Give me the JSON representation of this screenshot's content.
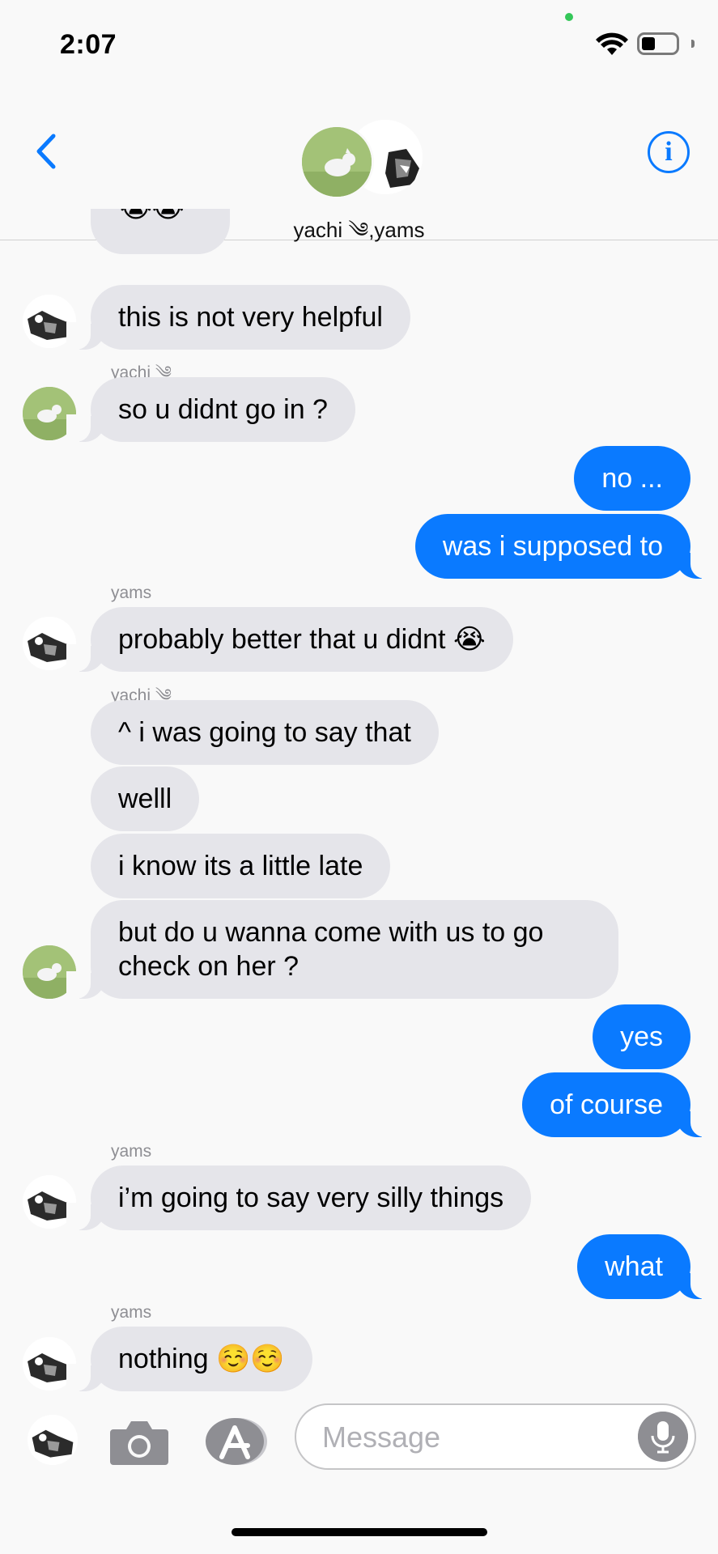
{
  "status": {
    "time": "2:07"
  },
  "header": {
    "group_name": "yachi ༄,yams",
    "back_icon": "chevron-left-icon",
    "info_icon": "info-icon"
  },
  "messages": [
    {
      "dir": "in",
      "text": "😭😭",
      "partial": true
    },
    {
      "dir": "in",
      "text": "this is not very helpful"
    },
    {
      "dir": "in",
      "sender": "yachi ༄",
      "text": "so u didnt go in ?"
    },
    {
      "dir": "out",
      "text": "no ..."
    },
    {
      "dir": "out",
      "text": "was i supposed to"
    },
    {
      "dir": "in",
      "sender": "yams",
      "text": "probably better that u didnt 😭"
    },
    {
      "dir": "in",
      "sender": "yachi ༄",
      "text": "^ i was going to say that"
    },
    {
      "dir": "in",
      "text": "welll"
    },
    {
      "dir": "in",
      "text": "i know its a little late"
    },
    {
      "dir": "in",
      "text_line1": "but do u wanna come with us to go",
      "text_line2": "check on her ?"
    },
    {
      "dir": "out",
      "text": "yes"
    },
    {
      "dir": "out",
      "text": "of course"
    },
    {
      "dir": "in",
      "sender": "yams",
      "text": "i’m going to say very silly things"
    },
    {
      "dir": "out",
      "text": "what"
    },
    {
      "dir": "in",
      "sender": "yams",
      "text": "nothing ☺️☺️"
    }
  ],
  "input": {
    "placeholder": "Message",
    "camera_icon": "camera-icon",
    "appstore_icon": "app-store-icon",
    "mic_icon": "microphone-icon"
  },
  "colors": {
    "outgoing": "#0a7aff",
    "incoming": "#e5e5ea",
    "background": "#f9f9f9"
  }
}
